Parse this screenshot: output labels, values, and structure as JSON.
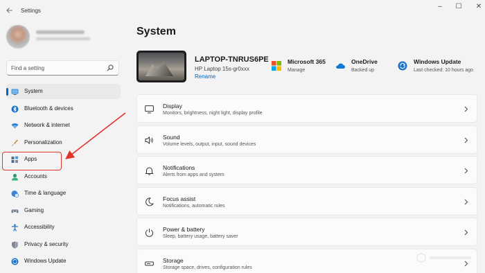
{
  "window": {
    "app_title": "Settings",
    "controls": {
      "minimize": "–",
      "maximize": "☐",
      "close": "✕"
    }
  },
  "sidebar": {
    "search": {
      "placeholder": "Find a setting"
    },
    "items": [
      {
        "label": "System",
        "icon": "monitor-icon",
        "active": true
      },
      {
        "label": "Bluetooth & devices",
        "icon": "bluetooth-icon"
      },
      {
        "label": "Network & internet",
        "icon": "wifi-icon"
      },
      {
        "label": "Personalization",
        "icon": "brush-icon"
      },
      {
        "label": "Apps",
        "icon": "apps-icon"
      },
      {
        "label": "Accounts",
        "icon": "person-icon"
      },
      {
        "label": "Time & language",
        "icon": "globe-clock-icon"
      },
      {
        "label": "Gaming",
        "icon": "gamepad-icon"
      },
      {
        "label": "Accessibility",
        "icon": "accessibility-icon"
      },
      {
        "label": "Privacy & security",
        "icon": "shield-icon"
      },
      {
        "label": "Windows Update",
        "icon": "update-icon"
      }
    ]
  },
  "main": {
    "title": "System",
    "device": {
      "name": "LAPTOP-TNRUS6PE",
      "model": "HP Laptop 15s-gr0xxx",
      "rename_label": "Rename"
    },
    "quick_links": [
      {
        "title": "Microsoft 365",
        "subtitle": "Manage",
        "icon": "microsoft-logo-icon"
      },
      {
        "title": "OneDrive",
        "subtitle": "Backed up",
        "icon": "cloud-icon"
      },
      {
        "title": "Windows Update",
        "subtitle": "Last checked: 10 hours ago",
        "icon": "update-icon"
      }
    ],
    "cards": [
      {
        "title": "Display",
        "subtitle": "Monitors, brightness, night light, display profile",
        "icon": "display-icon"
      },
      {
        "title": "Sound",
        "subtitle": "Volume levels, output, input, sound devices",
        "icon": "speaker-icon"
      },
      {
        "title": "Notifications",
        "subtitle": "Alerts from apps and system",
        "icon": "bell-icon"
      },
      {
        "title": "Focus assist",
        "subtitle": "Notifications, automatic rules",
        "icon": "moon-icon"
      },
      {
        "title": "Power & battery",
        "subtitle": "Sleep, battery usage, battery saver",
        "icon": "power-icon"
      },
      {
        "title": "Storage",
        "subtitle": "Storage space, drives, configuration rules",
        "icon": "storage-icon"
      }
    ]
  },
  "colors": {
    "accent": "#0067c0",
    "annotation": "#e0332b",
    "background": "#f3f3f3",
    "card": "#fbfbfb"
  }
}
